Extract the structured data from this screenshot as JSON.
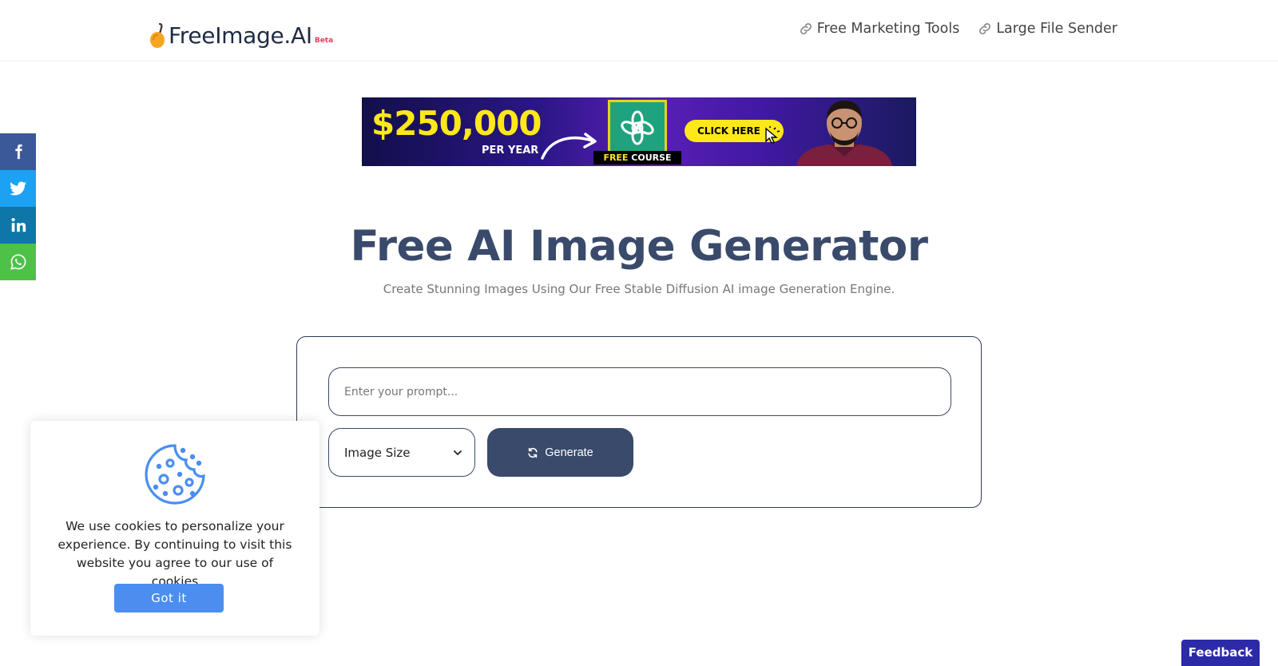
{
  "header": {
    "logo_text": "FreeImage.AI",
    "logo_badge": "Beta",
    "nav": [
      {
        "label": "Free Marketing Tools",
        "icon": "link-icon"
      },
      {
        "label": "Large File Sender",
        "icon": "link-icon"
      }
    ]
  },
  "banner": {
    "amount": "$250,000",
    "period": "PER YEAR",
    "course_prefix": "FREE",
    "course_suffix": " COURSE",
    "cta": "CLICK HERE"
  },
  "social": [
    {
      "name": "facebook",
      "color": "#3b5998"
    },
    {
      "name": "twitter",
      "color": "#1da1f2"
    },
    {
      "name": "linkedin",
      "color": "#0e76a8"
    },
    {
      "name": "whatsapp",
      "color": "#4dc247"
    }
  ],
  "main": {
    "title": "Free AI Image Generator",
    "subtitle": "Create Stunning Images Using Our Free Stable Diffusion AI image Generation Engine.",
    "prompt_placeholder": "Enter your prompt...",
    "prompt_value": "",
    "size_select": "Image Size",
    "generate_label": "Generate"
  },
  "cookie": {
    "text": "We use cookies to personalize your experience. By continuing to visit this website you agree to our use of cookies",
    "button": "Got it"
  },
  "feedback": "Feedback",
  "colors": {
    "primary": "#3a4a6b",
    "cookie_button": "#4b8ef0",
    "feedback": "#2d2aa8",
    "logo_badge": "#e53e5a"
  }
}
